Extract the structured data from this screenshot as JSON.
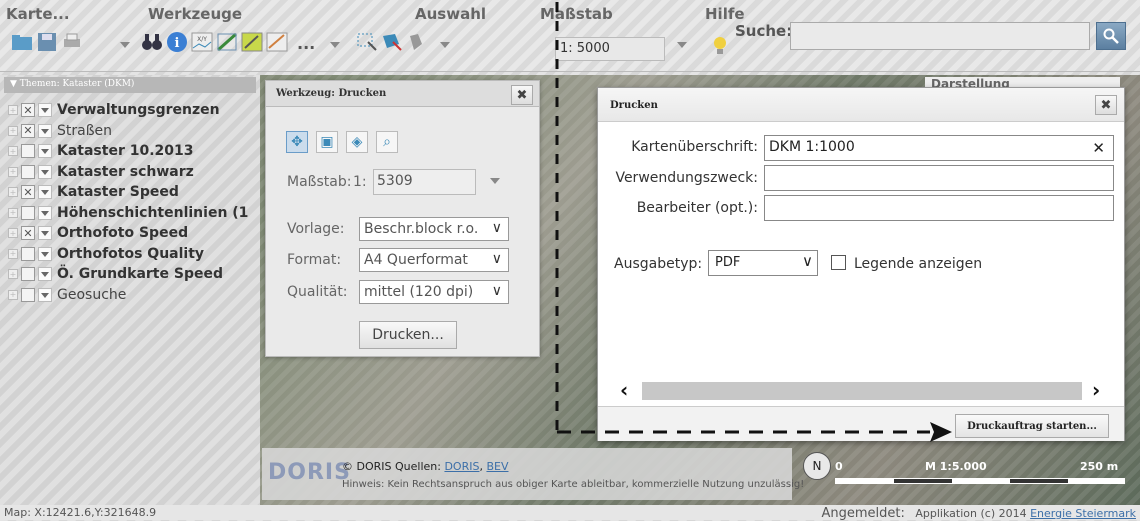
{
  "toolbar": {
    "menus": [
      "Karte...",
      "Werkzeuge",
      "Auswahl",
      "Maßstab",
      "Hilfe"
    ],
    "more_dots": "...",
    "scale_value": "1: 5000",
    "search_label": "Suche:",
    "search_placeholder": ""
  },
  "left_panel": {
    "header": "▼ Themen: Kataster (DKM)",
    "layers": [
      {
        "name": "Verwaltungsgrenzen",
        "checked": true,
        "bold": true
      },
      {
        "name": "Straßen",
        "checked": true,
        "bold": false
      },
      {
        "name": "Kataster 10.2013",
        "checked": false,
        "bold": true
      },
      {
        "name": "Kataster schwarz",
        "checked": false,
        "bold": true
      },
      {
        "name": "Kataster Speed",
        "checked": true,
        "bold": true
      },
      {
        "name": "Höhenschichtenlinien (1",
        "checked": false,
        "bold": true
      },
      {
        "name": "Orthofoto Speed",
        "checked": true,
        "bold": true
      },
      {
        "name": "Orthofotos Quality",
        "checked": false,
        "bold": true
      },
      {
        "name": "Ö. Grundkarte Speed",
        "checked": false,
        "bold": true
      },
      {
        "name": "Geosuche",
        "checked": false,
        "bold": false
      }
    ]
  },
  "tool_window": {
    "title": "Werkzeug: Drucken",
    "close": "✖",
    "scale_label": "Maßstab:",
    "scale_prefix": "1:",
    "scale_value": "5309",
    "template_label": "Vorlage:",
    "template_value": "Beschr.block r.o.",
    "format_label": "Format:",
    "format_value": "A4 Querformat",
    "quality_label": "Qualität:",
    "quality_value": "mittel (120 dpi)",
    "print_button": "Drucken..."
  },
  "print_dialog": {
    "title": "Drucken",
    "close": "✖",
    "heading_label": "Kartenüberschrift:",
    "heading_value": "DKM 1:1000",
    "purpose_label": "Verwendungszweck:",
    "purpose_value": "",
    "editor_label": "Bearbeiter (opt.):",
    "editor_value": "",
    "output_label": "Ausgabetyp:",
    "output_value": "PDF",
    "legend_label": "Legende anzeigen",
    "legend_checked": false,
    "start_button": "Druckauftrag starten..."
  },
  "darstellung_tab": "Darstellung",
  "attribution": {
    "logo": "DORIS",
    "line1_prefix": "© DORIS  Quellen: ",
    "source1": "DORIS",
    "sep": ", ",
    "source2": "BEV",
    "line2": "Hinweis: Kein Rechtsanspruch aus obiger Karte ableitbar, kommerzielle Nutzung unzulässig!"
  },
  "scalebar": {
    "start": "0",
    "ratio": "M 1:5.000",
    "end": "250 m",
    "north": "N"
  },
  "status": {
    "coords": "Map: X:12421.6,Y:321648.9",
    "logged_in": "Angemeldet:",
    "app": "Applikation (c) 2014 ",
    "link": "Energie Steiermark"
  },
  "colors": {
    "accent": "#3c8ab8",
    "link": "#3c6fa8"
  }
}
